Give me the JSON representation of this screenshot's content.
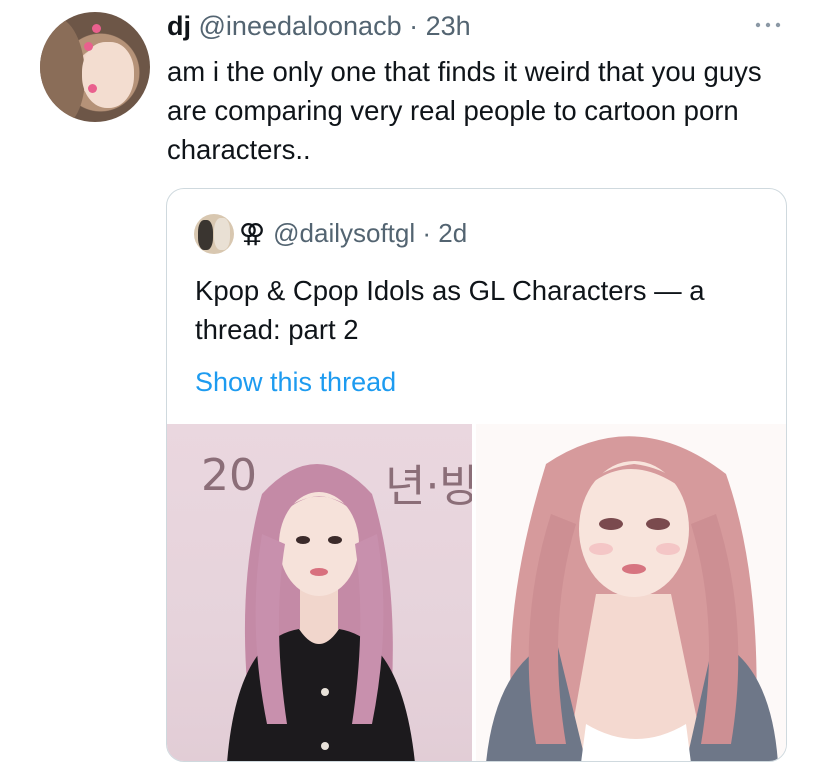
{
  "tweet": {
    "display_name": "dj",
    "handle": "@ineedaloonacb",
    "separator": " · ",
    "time": "23h",
    "text": "am i the only one that finds it weird that you guys are comparing very real people to cartoon porn characters.."
  },
  "quote": {
    "glyph": "⚢",
    "handle": "@dailysoftgl",
    "separator": " · ",
    "time": "2d",
    "text": "Kpop & Cpop Idols as GL Characters — a thread: part 2",
    "show_thread": "Show this thread",
    "media": {
      "left_backdrop_text": "20",
      "left_backdrop_text_2": "년·방"
    }
  },
  "icons": {
    "more": "more-horizontal-icon"
  },
  "colors": {
    "text_primary": "#0f1419",
    "text_secondary": "#536471",
    "link": "#1d9bf0",
    "border": "#cfd9de"
  }
}
